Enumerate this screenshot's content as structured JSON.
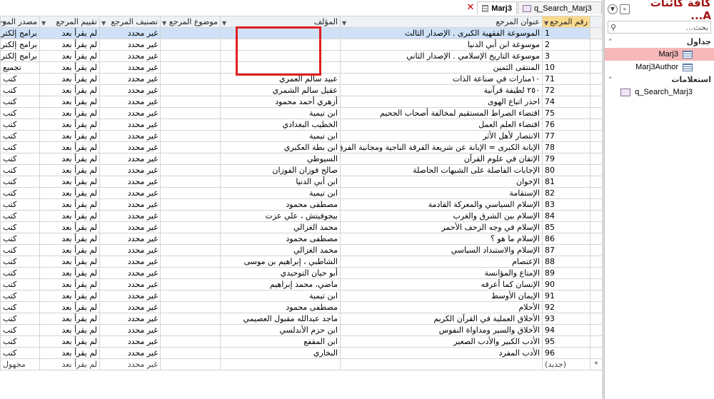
{
  "tabs": [
    {
      "label": "q_Search_Marj3",
      "active": false
    },
    {
      "label": "Marj3",
      "active": true
    }
  ],
  "columns": [
    "رقم المرجع",
    "عنوان المرجع",
    "المؤلف",
    "موضوع المرجع",
    "تصنيف المرجع",
    "تقييم المرجع",
    "مصدر المرجع"
  ],
  "rows": [
    {
      "id": "1",
      "title": "الموسوعة الفقهية الكبرى . الإصدار الثالث",
      "author": "",
      "subject": "",
      "class": "غير محدد",
      "rating": "لم يقرأ بعد",
      "source": "برامج إلكترونية"
    },
    {
      "id": "2",
      "title": "موسوعة ابن أبي الدنيا",
      "author": "",
      "subject": "",
      "class": "غير محدد",
      "rating": "لم يقرأ بعد",
      "source": "برامج إلكترونية"
    },
    {
      "id": "3",
      "title": "موسوعة التاريخ الإسلامي . الإصدار الثاني",
      "author": "",
      "subject": "",
      "class": "غير محدد",
      "rating": "لم يقرأ بعد",
      "source": "برامج إلكترونية"
    },
    {
      "id": "10",
      "title": "المنتقى الثمين",
      "author": "",
      "subject": "",
      "class": "غير محدد",
      "rating": "لم يقرأ بعد",
      "source": "تجميع"
    },
    {
      "id": "71",
      "title": "١٠منارات في صناعة الذات",
      "author": "عبيد سالم العمري",
      "subject": "",
      "class": "غير محدد",
      "rating": "لم يقرأ بعد",
      "source": "كتب"
    },
    {
      "id": "72",
      "title": "٢٥٠ لطيفة قرآنية",
      "author": "عقيل سالم الشمري",
      "subject": "",
      "class": "غير محدد",
      "rating": "لم يقرأ بعد",
      "source": "كتب"
    },
    {
      "id": "74",
      "title": "احذر اتباع الهوى",
      "author": "أزهري أحمد محمود",
      "subject": "",
      "class": "غير محدد",
      "rating": "لم يقرأ بعد",
      "source": "كتب"
    },
    {
      "id": "75",
      "title": "اقتضاء الصراط المستقيم لمخالفة أصحاب الجحيم",
      "author": "ابن تيمية",
      "subject": "",
      "class": "غير محدد",
      "rating": "لم يقرأ بعد",
      "source": "كتب"
    },
    {
      "id": "76",
      "title": "اقتضاء العلم العمل",
      "author": "الخطيب البغدادي",
      "subject": "",
      "class": "غير محدد",
      "rating": "لم يقرأ بعد",
      "source": "كتب"
    },
    {
      "id": "77",
      "title": "الانتصار لأهل الأثر",
      "author": "ابن تيمية",
      "subject": "",
      "class": "غير محدد",
      "rating": "لم يقرأ بعد",
      "source": "كتب"
    },
    {
      "id": "78",
      "title": "الإبانة الكبرى = الإبانة عن شريعة الفرقة الناجية ومجانبة الفرق المذمومة",
      "author": "ابن بطة العكبري",
      "subject": "",
      "class": "غير محدد",
      "rating": "لم يقرأ بعد",
      "source": "كتب"
    },
    {
      "id": "79",
      "title": "الإتقان في علوم القرآن",
      "author": "السيوطي",
      "subject": "",
      "class": "غير محدد",
      "rating": "لم يقرأ بعد",
      "source": "كتب"
    },
    {
      "id": "80",
      "title": "الإجابات الفاصلة على الشبهات الحاصلة",
      "author": "صالح فوزان الفوزان",
      "subject": "",
      "class": "غير محدد",
      "rating": "لم يقرأ بعد",
      "source": "كتب"
    },
    {
      "id": "81",
      "title": "الإخوان",
      "author": "ابن أبي الدنيا",
      "subject": "",
      "class": "غير محدد",
      "rating": "لم يقرأ بعد",
      "source": "كتب"
    },
    {
      "id": "82",
      "title": "الإستقامة",
      "author": "ابن تيمية",
      "subject": "",
      "class": "غير محدد",
      "rating": "لم يقرأ بعد",
      "source": "كتب"
    },
    {
      "id": "83",
      "title": "الإسلام السياسي والمعركة القادمة",
      "author": "مصطفى محمود",
      "subject": "",
      "class": "غير محدد",
      "rating": "لم يقرأ بعد",
      "source": "كتب"
    },
    {
      "id": "84",
      "title": "الإسلام بين الشرق والغرب",
      "author": "بيجوفيتش ، علي عزت",
      "subject": "",
      "class": "غير محدد",
      "rating": "لم يقرأ بعد",
      "source": "كتب"
    },
    {
      "id": "85",
      "title": "الإسلام في وجه الزحف الأحمر",
      "author": "محمد الغزالي",
      "subject": "",
      "class": "غير محدد",
      "rating": "لم يقرأ بعد",
      "source": "كتب"
    },
    {
      "id": "86",
      "title": "الإسلام ما هو ؟",
      "author": "مصطفى محمود",
      "subject": "",
      "class": "غير محدد",
      "rating": "لم يقرأ بعد",
      "source": "كتب"
    },
    {
      "id": "87",
      "title": "الإسلام والاستبداد السياسي",
      "author": "محمد الغزالي",
      "subject": "",
      "class": "غير محدد",
      "rating": "لم يقرأ بعد",
      "source": "كتب"
    },
    {
      "id": "88",
      "title": "الإعتصام",
      "author": "الشاطبي ، إبراهيم بن موسى",
      "subject": "",
      "class": "غير محدد",
      "rating": "لم يقرأ بعد",
      "source": "كتب"
    },
    {
      "id": "89",
      "title": "الإمتاع والمؤانسة",
      "author": "أبو حيان التوحيدي",
      "subject": "",
      "class": "غير محدد",
      "rating": "لم يقرأ بعد",
      "source": "كتب"
    },
    {
      "id": "90",
      "title": "الإنسان كما أعرفه",
      "author": "ماضي، محمد إبراهيم",
      "subject": "",
      "class": "غير محدد",
      "rating": "لم يقرأ بعد",
      "source": "كتب"
    },
    {
      "id": "91",
      "title": "الإيمان الأوسط",
      "author": "ابن تيمية",
      "subject": "",
      "class": "غير محدد",
      "rating": "لم يقرأ بعد",
      "source": "كتب"
    },
    {
      "id": "92",
      "title": "الأحلام",
      "author": "مصطفى محمود",
      "subject": "",
      "class": "غير محدد",
      "rating": "لم يقرأ بعد",
      "source": "كتب"
    },
    {
      "id": "93",
      "title": "الأخلاق العملية في القرآن الكريم",
      "author": "ماجد عبدالله مقبول العصيمي",
      "subject": "",
      "class": "غير محدد",
      "rating": "لم يقرأ بعد",
      "source": "كتب"
    },
    {
      "id": "94",
      "title": "الأخلاق والسير ومداواة النفوس",
      "author": "ابن حزم الأندلسي",
      "subject": "",
      "class": "غير محدد",
      "rating": "لم يقرأ بعد",
      "source": "كتب"
    },
    {
      "id": "95",
      "title": "الأدب الكبير والأدب الصغير",
      "author": "ابن المقفع",
      "subject": "",
      "class": "غير محدد",
      "rating": "لم يقرأ بعد",
      "source": "كتب"
    },
    {
      "id": "96",
      "title": "الأدب المفرد",
      "author": "البخاري",
      "subject": "",
      "class": "غير محدد",
      "rating": "لم يقرأ بعد",
      "source": "كتب"
    }
  ],
  "new_row": {
    "marker": "*",
    "id": "(جديد)",
    "class": "غير محدد",
    "rating": "لم يقرأ بعد",
    "source": "مجهول"
  },
  "nav": {
    "title": "كافة كائنات A...",
    "search_placeholder": "بحث...",
    "groups": [
      {
        "label": "جداول",
        "items": [
          "Marj3",
          "Marj3Author"
        ]
      },
      {
        "label": "استعلامات",
        "items": [
          "q_Search_Marj3"
        ]
      }
    ]
  },
  "colors": {
    "selected_row": "#cfe1f7",
    "nav_selected": "#f6b8b8",
    "highlight_box": "#e22020",
    "nav_title": "#a31515",
    "sorted_header": "#f9d98e"
  }
}
